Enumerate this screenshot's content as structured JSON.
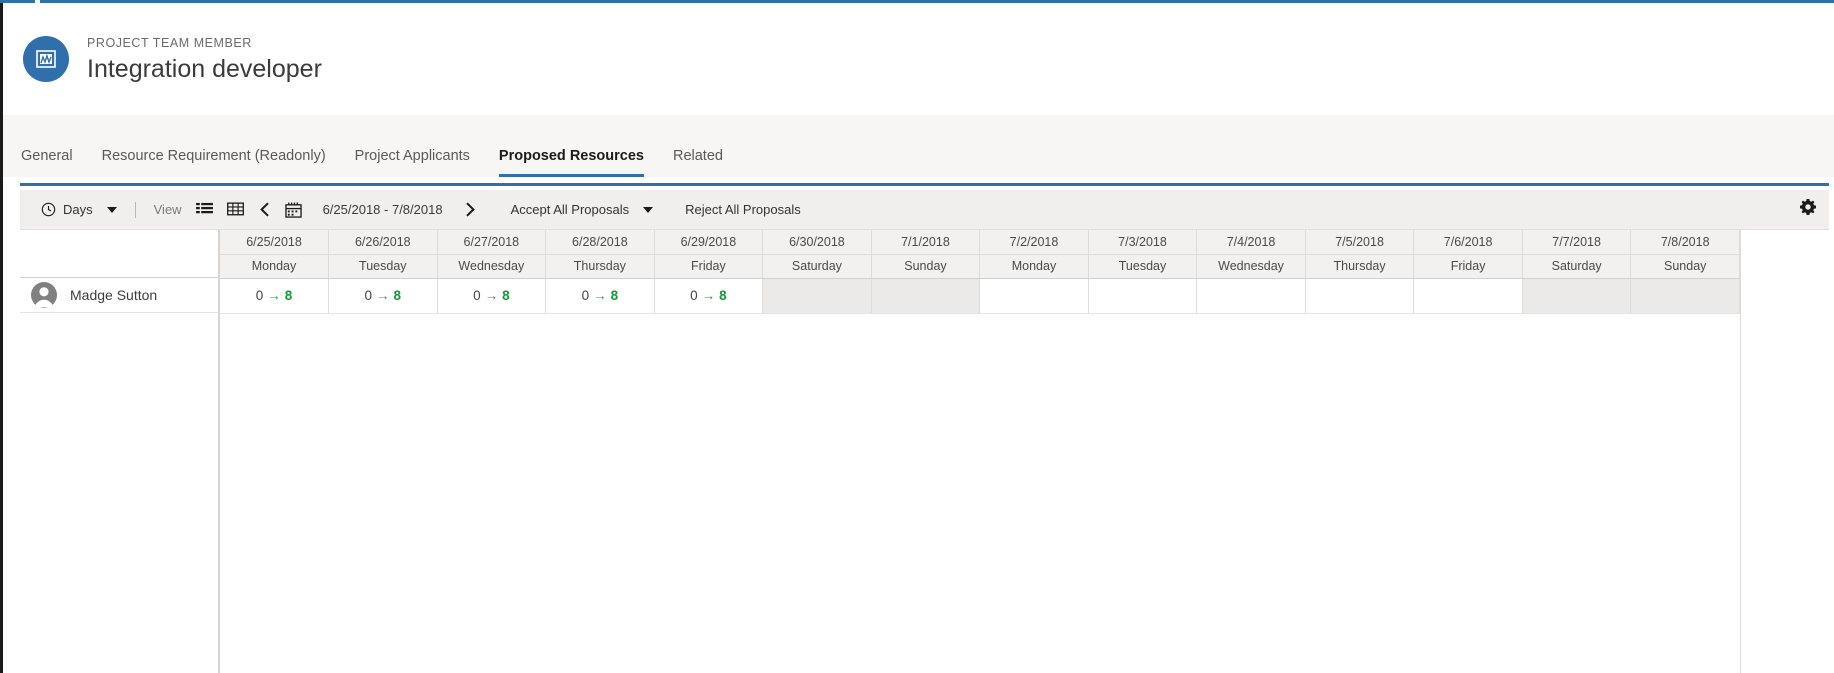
{
  "theme": {
    "accent": "#2f71ab",
    "avatar_blue": "#2f6fab",
    "proposal_green": "#0f9d35",
    "weekend_shade": "#eceae8",
    "toolbar_bg": "#f0efee",
    "tabstrip_bg": "#f7f6f5"
  },
  "header": {
    "entity_kind": "PROJECT TEAM MEMBER",
    "title": "Integration developer",
    "icon": "project-team-member-icon"
  },
  "tabs": [
    {
      "label": "General",
      "active": false
    },
    {
      "label": "Resource Requirement (Readonly)",
      "active": false
    },
    {
      "label": "Project Applicants",
      "active": false
    },
    {
      "label": "Proposed Resources",
      "active": true
    },
    {
      "label": "Related",
      "active": false
    }
  ],
  "toolbar": {
    "scale_icon": "clock-icon",
    "scale_label": "Days",
    "scale_caret": "chevron-down-icon",
    "view_label": "View",
    "list_view_icon": "list-view-icon",
    "grid_view_icon": "grid-view-icon",
    "prev_icon": "chevron-left-icon",
    "calendar_icon": "calendar-icon",
    "date_range": "6/25/2018 - 7/8/2018",
    "next_icon": "chevron-right-icon",
    "accept_all_label": "Accept All Proposals",
    "accept_all_caret": "chevron-down-icon",
    "reject_all_label": "Reject All Proposals",
    "settings_icon": "gear-icon"
  },
  "grid": {
    "resource_column_header": "",
    "columns": [
      {
        "date": "6/25/2018",
        "day": "Monday",
        "weekend": false
      },
      {
        "date": "6/26/2018",
        "day": "Tuesday",
        "weekend": false
      },
      {
        "date": "6/27/2018",
        "day": "Wednesday",
        "weekend": false
      },
      {
        "date": "6/28/2018",
        "day": "Thursday",
        "weekend": false
      },
      {
        "date": "6/29/2018",
        "day": "Friday",
        "weekend": false
      },
      {
        "date": "6/30/2018",
        "day": "Saturday",
        "weekend": true
      },
      {
        "date": "7/1/2018",
        "day": "Sunday",
        "weekend": true
      },
      {
        "date": "7/2/2018",
        "day": "Monday",
        "weekend": false
      },
      {
        "date": "7/3/2018",
        "day": "Tuesday",
        "weekend": false
      },
      {
        "date": "7/4/2018",
        "day": "Wednesday",
        "weekend": false
      },
      {
        "date": "7/5/2018",
        "day": "Thursday",
        "weekend": false
      },
      {
        "date": "7/6/2018",
        "day": "Friday",
        "weekend": false
      },
      {
        "date": "7/7/2018",
        "day": "Saturday",
        "weekend": true
      },
      {
        "date": "7/8/2018",
        "day": "Sunday",
        "weekend": true
      }
    ],
    "rows": [
      {
        "name": "Madge Sutton",
        "avatar": "person-avatar",
        "cells": [
          {
            "from": "0",
            "arrow": "→",
            "to": "8"
          },
          {
            "from": "0",
            "arrow": "→",
            "to": "8"
          },
          {
            "from": "0",
            "arrow": "→",
            "to": "8"
          },
          {
            "from": "0",
            "arrow": "→",
            "to": "8"
          },
          {
            "from": "0",
            "arrow": "→",
            "to": "8"
          },
          null,
          null,
          null,
          null,
          null,
          null,
          null,
          null,
          null
        ]
      }
    ]
  }
}
